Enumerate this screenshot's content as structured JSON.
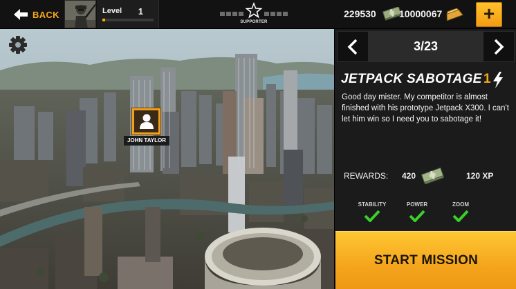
{
  "topbar": {
    "back_label": "BACK",
    "level_label": "Level",
    "level_value": "1",
    "level_progress": 0.06,
    "supporter_label": "SUPPORTER",
    "cash": "229530",
    "gold": "10000067",
    "add_currency_label": "+"
  },
  "map": {
    "target_name": "JOHN TAYLOR"
  },
  "mission": {
    "counter": "3/23",
    "title": "JETPACK SABOTAGE",
    "energy_cost": "1",
    "description": "Good day mister. My competitor is almost finished with his prototype Jetpack X300. I can't let him win so I need you to sabotage it!",
    "rewards_label": "REWARDS:",
    "reward_cash": "420",
    "reward_xp": "120 XP",
    "requirements": [
      {
        "label": "STABILITY",
        "met": true
      },
      {
        "label": "POWER",
        "met": true
      },
      {
        "label": "ZOOM",
        "met": true
      }
    ],
    "start_label": "START MISSION"
  },
  "colors": {
    "accent": "#f5a91a",
    "check": "#39d12a",
    "panel": "#1b1b1b"
  },
  "icons": [
    "back-arrow-icon",
    "soldier-avatar-icon",
    "star-icon",
    "cash-icon",
    "gold-bar-icon",
    "plus-icon",
    "gear-icon",
    "person-icon",
    "chevron-left-icon",
    "chevron-right-icon",
    "lightning-icon",
    "check-icon"
  ]
}
